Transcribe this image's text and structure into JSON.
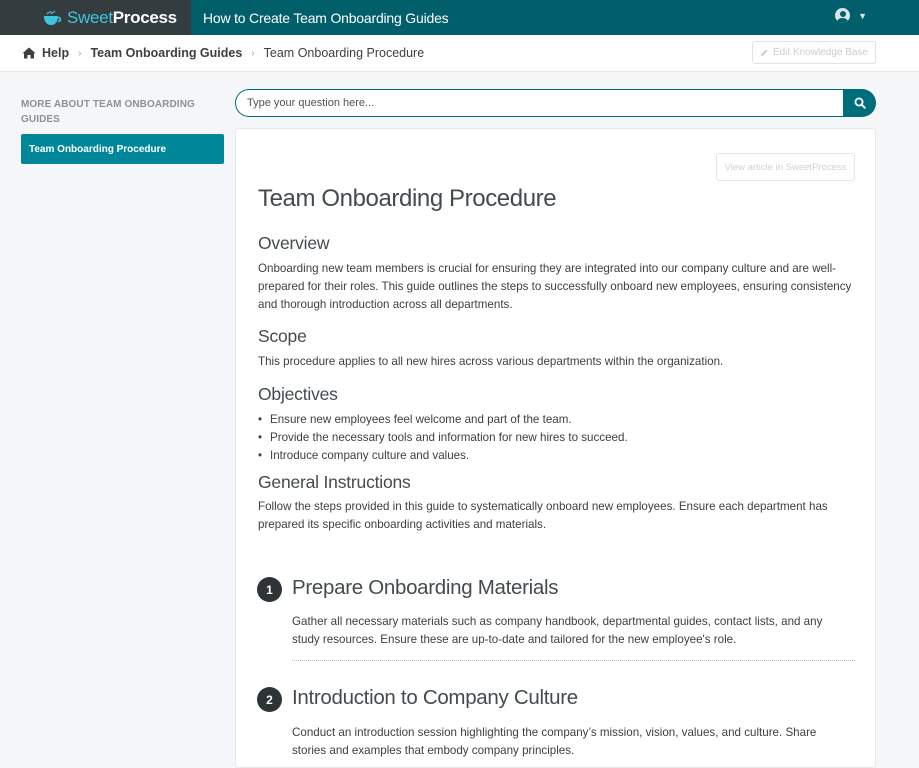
{
  "header": {
    "logo_sweet": "Sweet",
    "logo_process": "Process",
    "title": "How to Create Team Onboarding Guides"
  },
  "breadcrumb": {
    "items": [
      "Help",
      "Team Onboarding Guides",
      "Team Onboarding Procedure"
    ],
    "edit_label": "Edit Knowledge Base"
  },
  "sidebar": {
    "heading": "MORE ABOUT TEAM ONBOARDING GUIDES",
    "items": [
      {
        "label": "Team Onboarding Procedure",
        "active": true
      }
    ]
  },
  "search": {
    "placeholder": "Type your question here..."
  },
  "article": {
    "view_button": "View article in SweetProcess",
    "title": "Team Onboarding Procedure",
    "overview_heading": "Overview",
    "overview_text": "Onboarding new team members is crucial for ensuring they are integrated into our company culture and are well-prepared for their roles. This guide outlines the steps to successfully onboard new employees, ensuring consistency and thorough introduction across all departments.",
    "scope_heading": "Scope",
    "scope_text": "This procedure applies to all new hires across various departments within the organization.",
    "objectives_heading": "Objectives",
    "objectives": [
      "Ensure new employees feel welcome and part of the team.",
      "Provide the necessary tools and information for new hires to succeed.",
      "Introduce company culture and values."
    ],
    "general_heading": "General Instructions",
    "general_text": "Follow the steps provided in this guide to systematically onboard new employees. Ensure each department has prepared its specific onboarding activities and materials.",
    "steps": [
      {
        "number": "1",
        "title": "Prepare Onboarding Materials",
        "text": "Gather all necessary materials such as company handbook, departmental guides, contact lists, and any study resources. Ensure these are up-to-date and tailored for the new employee's role."
      },
      {
        "number": "2",
        "title": "Introduction to Company Culture",
        "text": "Conduct an introduction session highlighting the company’s mission, vision, values, and culture. Share stories and examples that embody company principles."
      }
    ]
  },
  "colors": {
    "topbar": "#005f6b",
    "logo_bg": "#333c3f",
    "accent": "#00879a",
    "step_badge": "#2e3436"
  }
}
